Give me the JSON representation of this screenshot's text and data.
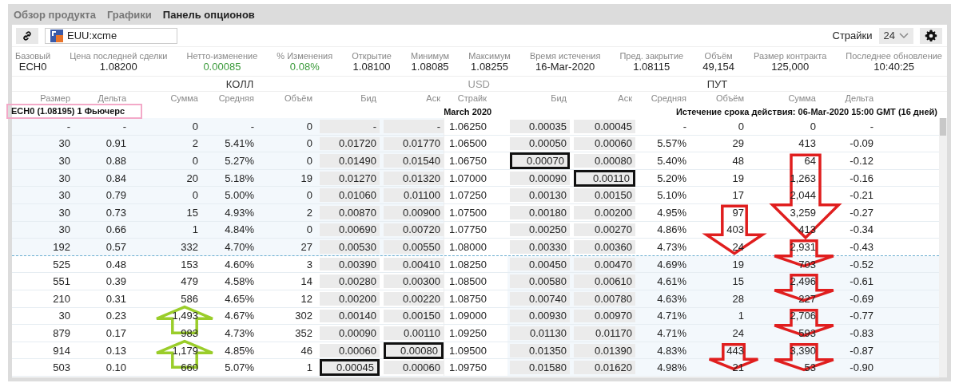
{
  "tabs": [
    {
      "label": "Обзор продукта",
      "selected": false
    },
    {
      "label": "Графики",
      "selected": false
    },
    {
      "label": "Панель опционов",
      "selected": true
    }
  ],
  "toolbar": {
    "symbol": "EUU:xcme",
    "strikes_label": "Страйки",
    "strikes_value": "24"
  },
  "stats": [
    {
      "label": "Базовый",
      "value": "ECH0",
      "positive": false
    },
    {
      "label": "Цена последней сделки",
      "value": "1.08200",
      "positive": false
    },
    {
      "label": "Нетто-изменение",
      "value": "0.00085",
      "positive": true
    },
    {
      "label": "% Изменения",
      "value": "0.08%",
      "positive": true
    },
    {
      "label": "Открытие",
      "value": "1.08100",
      "positive": false
    },
    {
      "label": "Минимум",
      "value": "1.08085",
      "positive": false
    },
    {
      "label": "Максимум",
      "value": "1.08255",
      "positive": false
    },
    {
      "label": "Время истечения",
      "value": "16-Mar-2020",
      "positive": false
    },
    {
      "label": "Пред. закрытие",
      "value": "1.08115",
      "positive": false
    },
    {
      "label": "Объём",
      "value": "49,154",
      "positive": false
    },
    {
      "label": "Размер контракта",
      "value": "125,000",
      "positive": false
    },
    {
      "label": "Последнее обновление",
      "value": "10:40:25",
      "positive": false
    }
  ],
  "sections": {
    "call": "КОЛЛ",
    "currency": "USD",
    "put": "ПУТ"
  },
  "columns": [
    "Размер",
    "Дельта",
    "Сумма",
    "Средняя",
    "Объём",
    "Бид",
    "Аск",
    "Страйк",
    "Бид",
    "Аск",
    "Средняя",
    "Объём",
    "Сумма",
    "Дельта"
  ],
  "future_label": {
    "text": "ECH0 (1.08195) 1 Фьючерс",
    "outlined": true
  },
  "month": "March 2020",
  "expiry": "Истечение срока действия: 06-Mar-2020 15:00 GMT (16 дней)",
  "rows": [
    {
      "strike": "1.06250",
      "call_itm": true,
      "put_itm": false,
      "call": [
        "-",
        "-",
        "0",
        "-",
        "0",
        "-",
        "-"
      ],
      "put": [
        "0.00035",
        "0.00045",
        "-",
        "0",
        "0",
        "-"
      ]
    },
    {
      "strike": "1.06500",
      "call_itm": true,
      "put_itm": false,
      "call": [
        "30",
        "0.91",
        "2",
        "5.41%",
        "0",
        "0.01720",
        "0.01770"
      ],
      "put": [
        "0.00050",
        "0.00060",
        "5.57%",
        "29",
        "413",
        "-0.09"
      ]
    },
    {
      "strike": "1.06750",
      "call_itm": true,
      "put_itm": false,
      "call": [
        "30",
        "0.88",
        "0",
        "5.27%",
        "0",
        "0.01490",
        "0.01540"
      ],
      "put": [
        {
          "text": "0.00070",
          "kind": "boxed"
        },
        "0.00080",
        "5.40%",
        "48",
        {
          "text": "64",
          "kind": "arrow-down-long"
        },
        "-0.12"
      ]
    },
    {
      "strike": "1.07000",
      "call_itm": true,
      "put_itm": false,
      "call": [
        "30",
        "0.84",
        "20",
        "5.18%",
        "19",
        "0.01270",
        "0.01320"
      ],
      "put": [
        "0.00090",
        {
          "text": "0.00110",
          "kind": "boxed"
        },
        "5.20%",
        "19",
        "1,263",
        "-0.16"
      ]
    },
    {
      "strike": "1.07250",
      "call_itm": true,
      "put_itm": false,
      "call": [
        "30",
        "0.79",
        "0",
        "5.00%",
        "0",
        "0.01060",
        "0.01100"
      ],
      "put": [
        "0.00130",
        "0.00150",
        "5.10%",
        "17",
        "2,044",
        "-0.21"
      ]
    },
    {
      "strike": "1.07500",
      "call_itm": true,
      "put_itm": false,
      "call": [
        "30",
        "0.73",
        "15",
        "4.93%",
        "2",
        "0.00870",
        "0.00900"
      ],
      "put": [
        "0.00180",
        "0.00200",
        "4.95%",
        {
          "text": "97",
          "kind": "arrow-down-mid"
        },
        "3,259",
        "-0.27"
      ]
    },
    {
      "strike": "1.07750",
      "call_itm": true,
      "put_itm": false,
      "call": [
        "30",
        "0.66",
        "1",
        "4.84%",
        "0",
        "0.00690",
        "0.00720"
      ],
      "put": [
        "0.00250",
        "0.00270",
        "4.86%",
        "403",
        "413",
        "-0.34"
      ]
    },
    {
      "strike": "1.08000",
      "call_itm": true,
      "put_itm": false,
      "call": [
        "192",
        "0.57",
        "332",
        "4.70%",
        "27",
        "0.00530",
        "0.00550"
      ],
      "put": [
        "0.00330",
        "0.00360",
        "4.73%",
        "24",
        {
          "text": "2,931",
          "kind": "arrow-down"
        },
        "-0.43"
      ]
    },
    {
      "strike": "1.08250",
      "call_itm": false,
      "put_itm": true,
      "call": [
        "525",
        "0.48",
        "153",
        "4.60%",
        "3",
        "0.00390",
        "0.00410"
      ],
      "put": [
        "0.00450",
        "0.00470",
        "4.69%",
        "19",
        "703",
        "-0.52"
      ]
    },
    {
      "strike": "1.08500",
      "call_itm": false,
      "put_itm": true,
      "call": [
        "551",
        "0.39",
        "479",
        "4.58%",
        "14",
        "0.00280",
        "0.00300"
      ],
      "put": [
        "0.00580",
        "0.00610",
        "4.61%",
        "15",
        {
          "text": "2,496",
          "kind": "arrow-down"
        },
        "-0.61"
      ]
    },
    {
      "strike": "1.08750",
      "call_itm": false,
      "put_itm": true,
      "call": [
        "210",
        "0.31",
        "586",
        "4.65%",
        "12",
        "0.00200",
        "0.00220"
      ],
      "put": [
        "0.00740",
        "0.00780",
        "4.63%",
        "28",
        "227",
        "-0.69"
      ]
    },
    {
      "strike": "1.09000",
      "call_itm": false,
      "put_itm": true,
      "call": [
        "30",
        "0.23",
        {
          "text": "1,493",
          "kind": "arrow-up"
        },
        "4.67%",
        "302",
        "0.00140",
        "0.00150"
      ],
      "put": [
        "0.00930",
        "0.00970",
        "4.71%",
        "1",
        {
          "text": "2,706",
          "kind": "arrow-down"
        },
        "-0.77"
      ]
    },
    {
      "strike": "1.09250",
      "call_itm": false,
      "put_itm": true,
      "call": [
        "879",
        "0.17",
        "983",
        "4.73%",
        "352",
        "0.00090",
        "0.00110"
      ],
      "put": [
        "0.01130",
        "0.01170",
        "4.71%",
        "24",
        "593",
        "-0.83"
      ]
    },
    {
      "strike": "1.09500",
      "call_itm": false,
      "put_itm": true,
      "call": [
        "914",
        "0.13",
        {
          "text": "1,179",
          "kind": "arrow-up"
        },
        "4.85%",
        "46",
        "0.00060",
        {
          "text": "0.00080",
          "kind": "boxed"
        }
      ],
      "put": [
        "0.01350",
        "0.01390",
        "4.83%",
        {
          "text": "443",
          "kind": "arrow-down-small"
        },
        {
          "text": "3,390",
          "kind": "arrow-down"
        },
        "-0.87"
      ]
    },
    {
      "strike": "1.09750",
      "call_itm": false,
      "put_itm": true,
      "call": [
        "503",
        "0.10",
        "660",
        "5.07%",
        "1",
        {
          "text": "0.00045",
          "kind": "boxed"
        },
        "0.00060"
      ],
      "put": [
        "0.01580",
        "0.01620",
        "4.98%",
        "21",
        "53",
        "-0.90"
      ]
    }
  ]
}
